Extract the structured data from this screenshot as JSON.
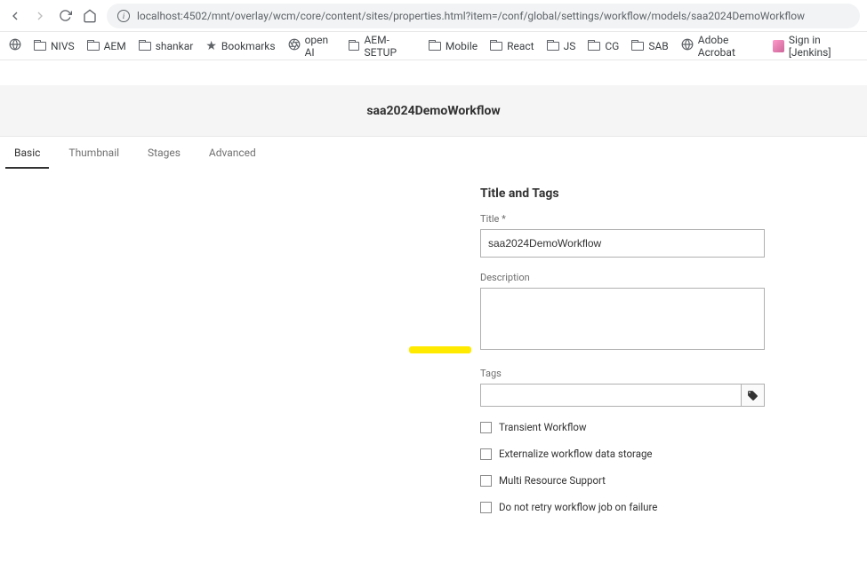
{
  "browser": {
    "url": "localhost:4502/mnt/overlay/wcm/core/content/sites/properties.html?item=/conf/global/settings/workflow/models/saa2024DemoWorkflow"
  },
  "bookmarks": {
    "items": [
      {
        "label": "NIVS",
        "type": "folder"
      },
      {
        "label": "AEM",
        "type": "folder"
      },
      {
        "label": "shankar",
        "type": "folder"
      },
      {
        "label": "Bookmarks",
        "type": "star"
      },
      {
        "label": "open AI",
        "type": "aperture"
      },
      {
        "label": "AEM-SETUP",
        "type": "folder"
      },
      {
        "label": "Mobile",
        "type": "folder"
      },
      {
        "label": "React",
        "type": "folder"
      },
      {
        "label": "JS",
        "type": "folder"
      },
      {
        "label": "CG",
        "type": "folder"
      },
      {
        "label": "SAB",
        "type": "folder"
      },
      {
        "label": "Adobe Acrobat",
        "type": "globe"
      },
      {
        "label": "Sign in [Jenkins]",
        "type": "avatar"
      }
    ]
  },
  "header": {
    "title": "saa2024DemoWorkflow"
  },
  "tabs": {
    "items": [
      "Basic",
      "Thumbnail",
      "Stages",
      "Advanced"
    ],
    "active": 0
  },
  "form": {
    "section_title": "Title and Tags",
    "title_label": "Title *",
    "title_value": "saa2024DemoWorkflow",
    "description_label": "Description",
    "description_value": "",
    "tags_label": "Tags",
    "checkboxes": [
      {
        "label": "Transient Workflow",
        "checked": false
      },
      {
        "label": "Externalize workflow data storage",
        "checked": false
      },
      {
        "label": "Multi Resource Support",
        "checked": false
      },
      {
        "label": "Do not retry workflow job on failure",
        "checked": false
      }
    ]
  }
}
